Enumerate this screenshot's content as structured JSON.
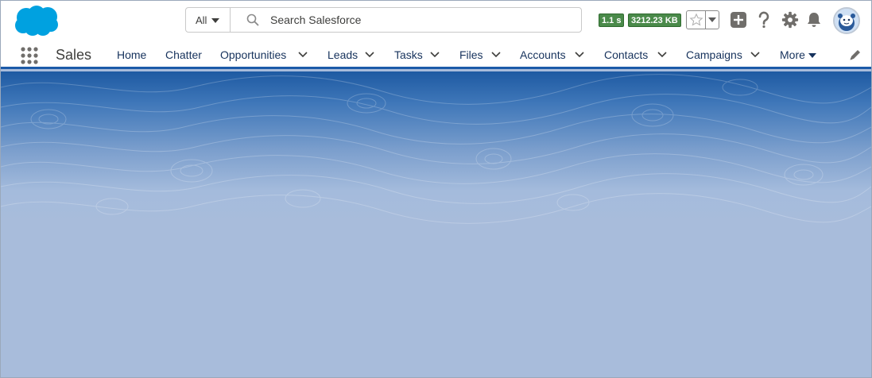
{
  "search": {
    "scope_label": "All",
    "placeholder": "Search Salesforce"
  },
  "perf": {
    "time": "1.1 s",
    "size": "3212.23 KB"
  },
  "app": {
    "name": "Sales"
  },
  "nav": {
    "items": [
      {
        "label": "Home",
        "dropdown": false
      },
      {
        "label": "Chatter",
        "dropdown": false
      },
      {
        "label": "Opportunities",
        "dropdown": true
      },
      {
        "label": "Leads",
        "dropdown": true
      },
      {
        "label": "Tasks",
        "dropdown": true
      },
      {
        "label": "Files",
        "dropdown": true
      },
      {
        "label": "Accounts",
        "dropdown": true
      },
      {
        "label": "Contacts",
        "dropdown": true
      },
      {
        "label": "Campaigns",
        "dropdown": true
      }
    ],
    "more_label": "More"
  },
  "colors": {
    "brand": "#00a1e0",
    "nav_accent": "#1b5aa8",
    "badge_green": "#4a8a4a",
    "icon_gray": "#706e6b"
  },
  "icons": {
    "logo": "salesforce-cloud-logo",
    "search": "search-icon",
    "favorite": "star-icon",
    "global_actions": "add-icon",
    "help": "help-icon",
    "setup": "gear-icon",
    "notifications": "bell-icon",
    "app_launcher": "waffle-icon",
    "edit_nav": "pencil-icon"
  }
}
